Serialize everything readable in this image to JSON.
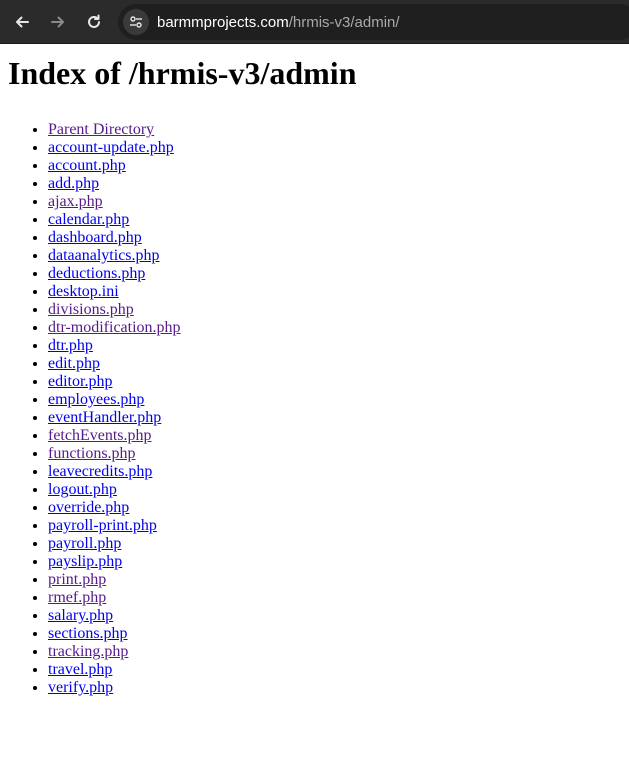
{
  "browser": {
    "url_host": "barmmprojects.com",
    "url_path": "/hrmis-v3/admin/"
  },
  "colors": {
    "link": "#0000ee",
    "visited": "#551a8b"
  },
  "page": {
    "heading": "Index of /hrmis-v3/admin",
    "entries": [
      {
        "label": "Parent Directory",
        "visited": true
      },
      {
        "label": "account-update.php",
        "visited": false
      },
      {
        "label": "account.php",
        "visited": false
      },
      {
        "label": "add.php",
        "visited": false
      },
      {
        "label": "ajax.php",
        "visited": true
      },
      {
        "label": "calendar.php",
        "visited": false
      },
      {
        "label": "dashboard.php",
        "visited": false
      },
      {
        "label": "dataanalytics.php",
        "visited": false
      },
      {
        "label": "deductions.php",
        "visited": false
      },
      {
        "label": "desktop.ini",
        "visited": false
      },
      {
        "label": "divisions.php",
        "visited": true
      },
      {
        "label": "dtr-modification.php",
        "visited": true
      },
      {
        "label": "dtr.php",
        "visited": false
      },
      {
        "label": "edit.php",
        "visited": false
      },
      {
        "label": "editor.php",
        "visited": false
      },
      {
        "label": "employees.php",
        "visited": false
      },
      {
        "label": "eventHandler.php",
        "visited": false
      },
      {
        "label": "fetchEvents.php",
        "visited": true
      },
      {
        "label": "functions.php",
        "visited": true
      },
      {
        "label": "leavecredits.php",
        "visited": false
      },
      {
        "label": "logout.php",
        "visited": false
      },
      {
        "label": "override.php",
        "visited": false
      },
      {
        "label": "payroll-print.php",
        "visited": false
      },
      {
        "label": "payroll.php",
        "visited": false
      },
      {
        "label": "payslip.php",
        "visited": false
      },
      {
        "label": "print.php",
        "visited": true
      },
      {
        "label": "rmef.php",
        "visited": true
      },
      {
        "label": "salary.php",
        "visited": false
      },
      {
        "label": "sections.php",
        "visited": false
      },
      {
        "label": "tracking.php",
        "visited": true
      },
      {
        "label": "travel.php",
        "visited": false
      },
      {
        "label": "verify.php",
        "visited": false
      }
    ]
  }
}
